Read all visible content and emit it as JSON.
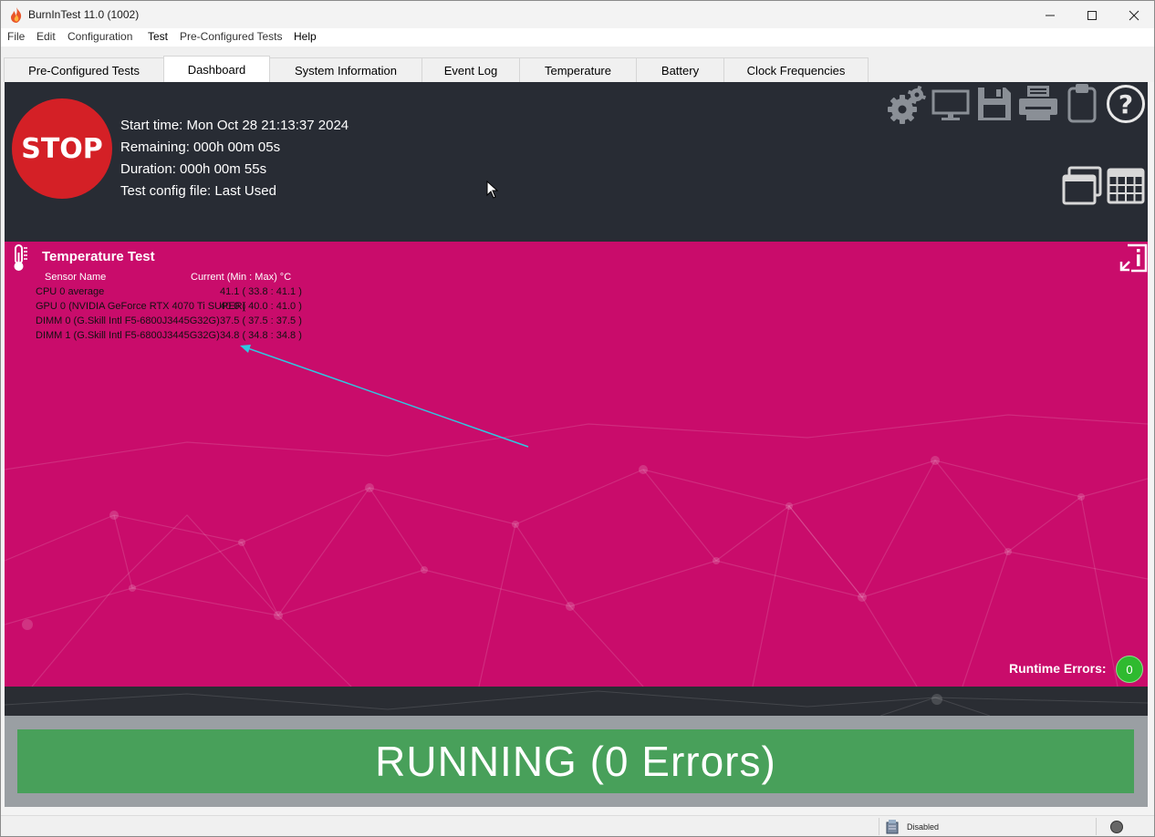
{
  "window": {
    "title": "BurnInTest 11.0 (1002)"
  },
  "menu": {
    "items": [
      "File",
      "Edit",
      "Configuration",
      "Test",
      "Pre-Configured Tests",
      "Help"
    ]
  },
  "tabs": [
    "Pre-Configured Tests",
    "Dashboard",
    "System Information",
    "Event Log",
    "Temperature",
    "Battery",
    "Clock Frequencies"
  ],
  "active_tab": "Dashboard",
  "header": {
    "stop_label": "STOP",
    "start_time": "Start time: Mon Oct 28 21:13:37 2024",
    "remaining": "Remaining: 000h 00m 05s",
    "duration": "Duration: 000h 00m 55s",
    "config_file": "Test config file: Last Used"
  },
  "panel": {
    "title": "Temperature Test",
    "col_sensor": "Sensor Name",
    "col_current": "Current (Min : Max) °C",
    "sensors": [
      {
        "name": "CPU 0 average",
        "value": "41.1 ( 33.8 : 41.1 )"
      },
      {
        "name": "GPU 0 (NVIDIA GeForce RTX 4070 Ti SUPER)",
        "value": "40.0 ( 40.0 : 41.0 )"
      },
      {
        "name": "DIMM 0 (G.Skill Intl F5-6800J3445G32G)",
        "value": "37.5 ( 37.5 : 37.5 )"
      },
      {
        "name": "DIMM 1 (G.Skill Intl F5-6800J3445G32G)",
        "value": "34.8 ( 34.8 : 34.8 )"
      }
    ],
    "runtime_errors_label": "Runtime Errors:",
    "runtime_errors_count": "0"
  },
  "banner": {
    "text": "RUNNING (0 Errors)"
  },
  "statusbar": {
    "text": "Disabled"
  },
  "colors": {
    "header_bg": "#282c34",
    "stop_red": "#d42026",
    "panel_pink": "#c90c6b",
    "banner_green": "#48a05a",
    "badge_green": "#2fba2f",
    "arrow_cyan": "#2fc8e0"
  }
}
